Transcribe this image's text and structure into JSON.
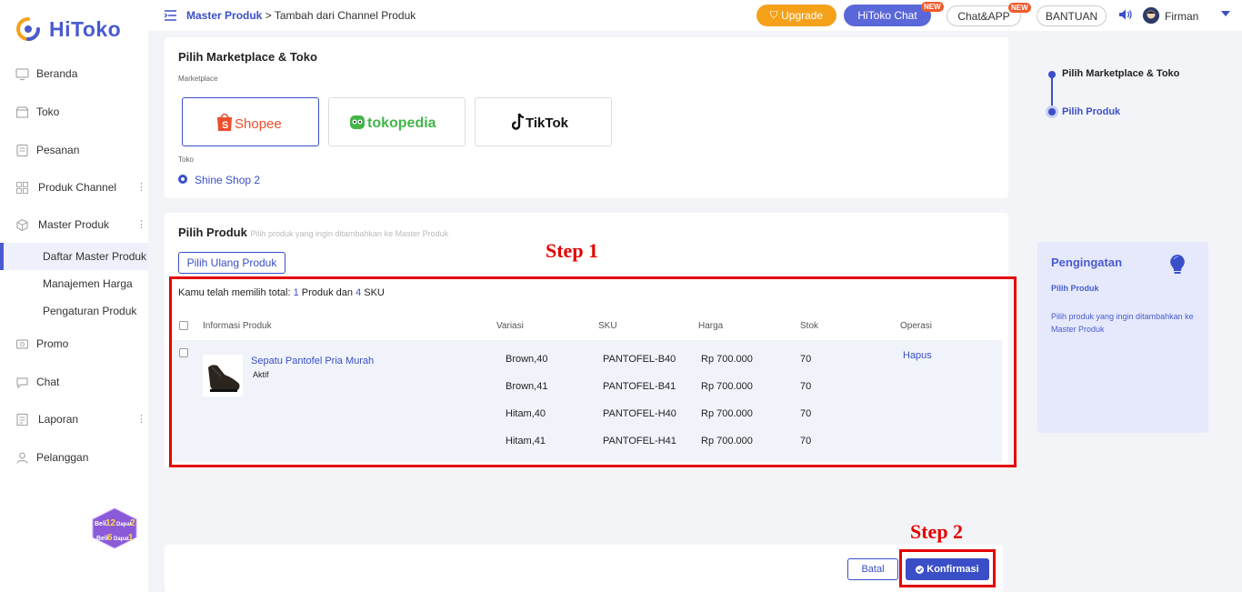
{
  "brand": {
    "name": "HiToko"
  },
  "sidebar": {
    "items": [
      {
        "label": "Beranda",
        "icon": "monitor-icon"
      },
      {
        "label": "Toko",
        "icon": "store-icon"
      },
      {
        "label": "Pesanan",
        "icon": "order-icon"
      },
      {
        "label": "Produk Channel",
        "icon": "grid-icon"
      },
      {
        "label": "Master Produk",
        "icon": "box-icon"
      }
    ],
    "sub_items": [
      {
        "label": "Daftar Master Produk"
      },
      {
        "label": "Manajemen Harga"
      },
      {
        "label": "Pengaturan Produk"
      }
    ],
    "items_after": [
      {
        "label": "Promo",
        "icon": "promo-icon"
      },
      {
        "label": "Chat",
        "icon": "chat-icon"
      },
      {
        "label": "Laporan",
        "icon": "report-icon"
      },
      {
        "label": "Pelanggan",
        "icon": "customer-icon"
      }
    ],
    "promo": {
      "line1_a": "Beli",
      "line1_b": "12",
      "line1_c": "Dapat",
      "line1_d": "2",
      "line2_a": "Beli",
      "line2_b": "6",
      "line2_c": "Dapat",
      "line2_d": "1"
    }
  },
  "header": {
    "breadcrumb_link": "Master Produk",
    "breadcrumb_sep": " > ",
    "breadcrumb_current": "Tambah dari Channel Produk",
    "upgrade_label": "Upgrade",
    "hichat_label": "HiToko Chat",
    "chatapp_label": "Chat&APP",
    "new_badge": "NEW",
    "bantuan_label": "BANTUAN",
    "username": "Firman"
  },
  "marketplace_section": {
    "title": "Pilih Marketplace & Toko",
    "marketplace_label": "Marketplace",
    "marketplaces": [
      "Shopee",
      "tokopedia",
      "TikTok"
    ],
    "toko_label": "Toko",
    "shop_name": "Shine Shop 2"
  },
  "product_section": {
    "title": "Pilih Produk",
    "hint": "Pilih produk yang ingin ditambahkan ke Master Produk",
    "reselect_label": "Pilih Ulang Produk",
    "summary_prefix": "Kamu telah memilih total: ",
    "summary_count_products": "1",
    "summary_mid": " Produk dan ",
    "summary_count_sku": "4",
    "summary_suffix": " SKU",
    "columns": [
      "Informasi Produk",
      "Variasi",
      "SKU",
      "Harga",
      "Stok",
      "Operasi"
    ],
    "product": {
      "name": "Sepatu Pantofel Pria Murah",
      "status": "Aktif",
      "action": "Hapus",
      "variants": [
        {
          "variasi": "Brown,40",
          "sku": "PANTOFEL-B40",
          "harga": "Rp 700.000",
          "stok": "70"
        },
        {
          "variasi": "Brown,41",
          "sku": "PANTOFEL-B41",
          "harga": "Rp 700.000",
          "stok": "70"
        },
        {
          "variasi": "Hitam,40",
          "sku": "PANTOFEL-H40",
          "harga": "Rp 700.000",
          "stok": "70"
        },
        {
          "variasi": "Hitam,41",
          "sku": "PANTOFEL-H41",
          "harga": "Rp 700.000",
          "stok": "70"
        }
      ]
    }
  },
  "annotations": {
    "step1": "Step 1",
    "step2": "Step 2"
  },
  "steps": [
    "Pilih Marketplace & Toko",
    "Pilih Produk"
  ],
  "reminder": {
    "title": "Pengingatan",
    "subtitle": "Pilih Produk",
    "description": "Pilih produk yang ingin ditambahkan ke Master Produk"
  },
  "footer": {
    "cancel_label": "Batal",
    "confirm_label": "Konfirmasi"
  },
  "colors": {
    "primary": "#3a4fc7",
    "accent_orange": "#f5a11a",
    "annotation_red": "#e30000",
    "shopee": "#ee4d2d",
    "tokopedia": "#42b549"
  }
}
